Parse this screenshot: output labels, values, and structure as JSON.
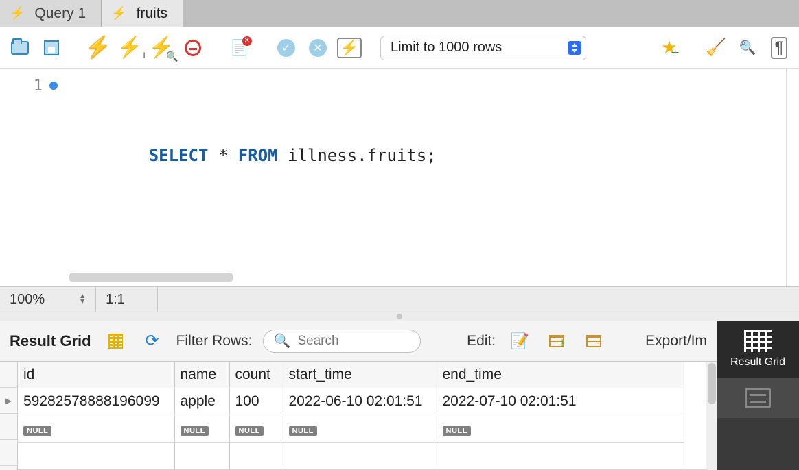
{
  "tabs": [
    {
      "label": "Query 1",
      "active": false
    },
    {
      "label": "fruits",
      "active": true
    }
  ],
  "toolbar": {
    "limit_label": "Limit to 1000 rows"
  },
  "editor": {
    "line_number": "1",
    "kw_select": "SELECT",
    "star": " * ",
    "kw_from": "FROM",
    "rest": " illness.fruits;"
  },
  "status": {
    "zoom": "100%",
    "cursor": "1:1"
  },
  "result_toolbar": {
    "title": "Result Grid",
    "filter_label": "Filter Rows:",
    "search_placeholder": "Search",
    "edit_label": "Edit:",
    "export_label": "Export/Im"
  },
  "columns": [
    "id",
    "name",
    "count",
    "start_time",
    "end_time"
  ],
  "rows": [
    {
      "id": "59282578888196099",
      "name": "apple",
      "count": "100",
      "start_time": "2022-06-10 02:01:51",
      "end_time": "2022-07-10 02:01:51"
    }
  ],
  "null_label": "NULL",
  "side": {
    "result_grid": "Result Grid"
  }
}
